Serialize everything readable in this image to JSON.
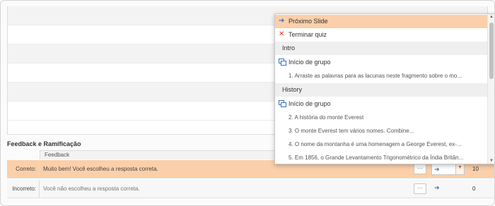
{
  "feedback": {
    "section_title": "Feedback e Ramificação",
    "column_header": "Feedback",
    "rows": [
      {
        "label": "Correto:",
        "text": "Muito bem! Você escolheu a resposta correta.",
        "dots": "···",
        "score": "10"
      },
      {
        "label": "Incorreto:",
        "text": "Você não escolheu a resposta correta.",
        "dots": "···",
        "score": "0"
      }
    ]
  },
  "dropdown": {
    "items": [
      {
        "kind": "action",
        "icon": "arrow-right-icon",
        "label": "Próximo Slide"
      },
      {
        "kind": "action",
        "icon": "close-icon",
        "label": "Terminar quiz"
      },
      {
        "kind": "group",
        "label": "Intro"
      },
      {
        "kind": "group-start",
        "icon": "group-icon",
        "label": "Início de grupo"
      },
      {
        "kind": "slide",
        "label": "1. Arraste as palavras para as lacunas neste fragmento sobre o mo..."
      },
      {
        "kind": "group",
        "label": "History"
      },
      {
        "kind": "group-start",
        "icon": "group-icon",
        "label": "Início de grupo"
      },
      {
        "kind": "slide",
        "label": "2. A história do monte Everest"
      },
      {
        "kind": "slide",
        "label": "3. O monte Everest tem vários nomes. Combine..."
      },
      {
        "kind": "slide",
        "label": "4. O nome da montanha é uma homenagem a George Everest, ex-..."
      },
      {
        "kind": "slide",
        "label": "5. Em 1856, o Grande Levantamento Trigonométrico da Índia Britân..."
      }
    ]
  },
  "colors": {
    "selected": "#fbcfa9",
    "accent_arrow": "#3a6fc4",
    "close_red": "#d9342b"
  }
}
